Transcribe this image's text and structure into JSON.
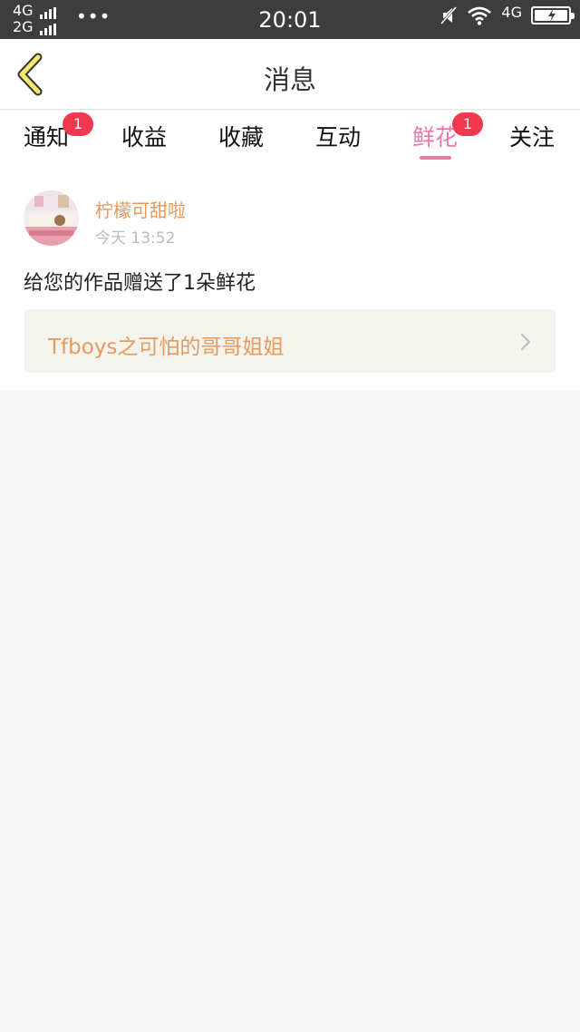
{
  "status_bar": {
    "net1": "4G",
    "net2": "2G",
    "dots": "•••",
    "time": "20:01",
    "net_right": "4G"
  },
  "header": {
    "title": "消息",
    "back_icon": "chevron-left-icon",
    "back_color": "#f2e86b"
  },
  "tabs": [
    {
      "label": "通知",
      "badge": "1"
    },
    {
      "label": "收益",
      "badge": ""
    },
    {
      "label": "收藏",
      "badge": ""
    },
    {
      "label": "互动",
      "badge": ""
    },
    {
      "label": "鲜花",
      "badge": "1",
      "active": true
    },
    {
      "label": "关注",
      "badge": ""
    }
  ],
  "message": {
    "sender": "柠檬可甜啦",
    "time": "今天 13:52",
    "text": "给您的作品赠送了1朵鲜花",
    "link_text": "Tfboys之可怕的哥哥姐姐"
  },
  "colors": {
    "accent_pink": "#e77aa9",
    "accent_orange": "#e8995b",
    "badge_red": "#f0394f"
  }
}
